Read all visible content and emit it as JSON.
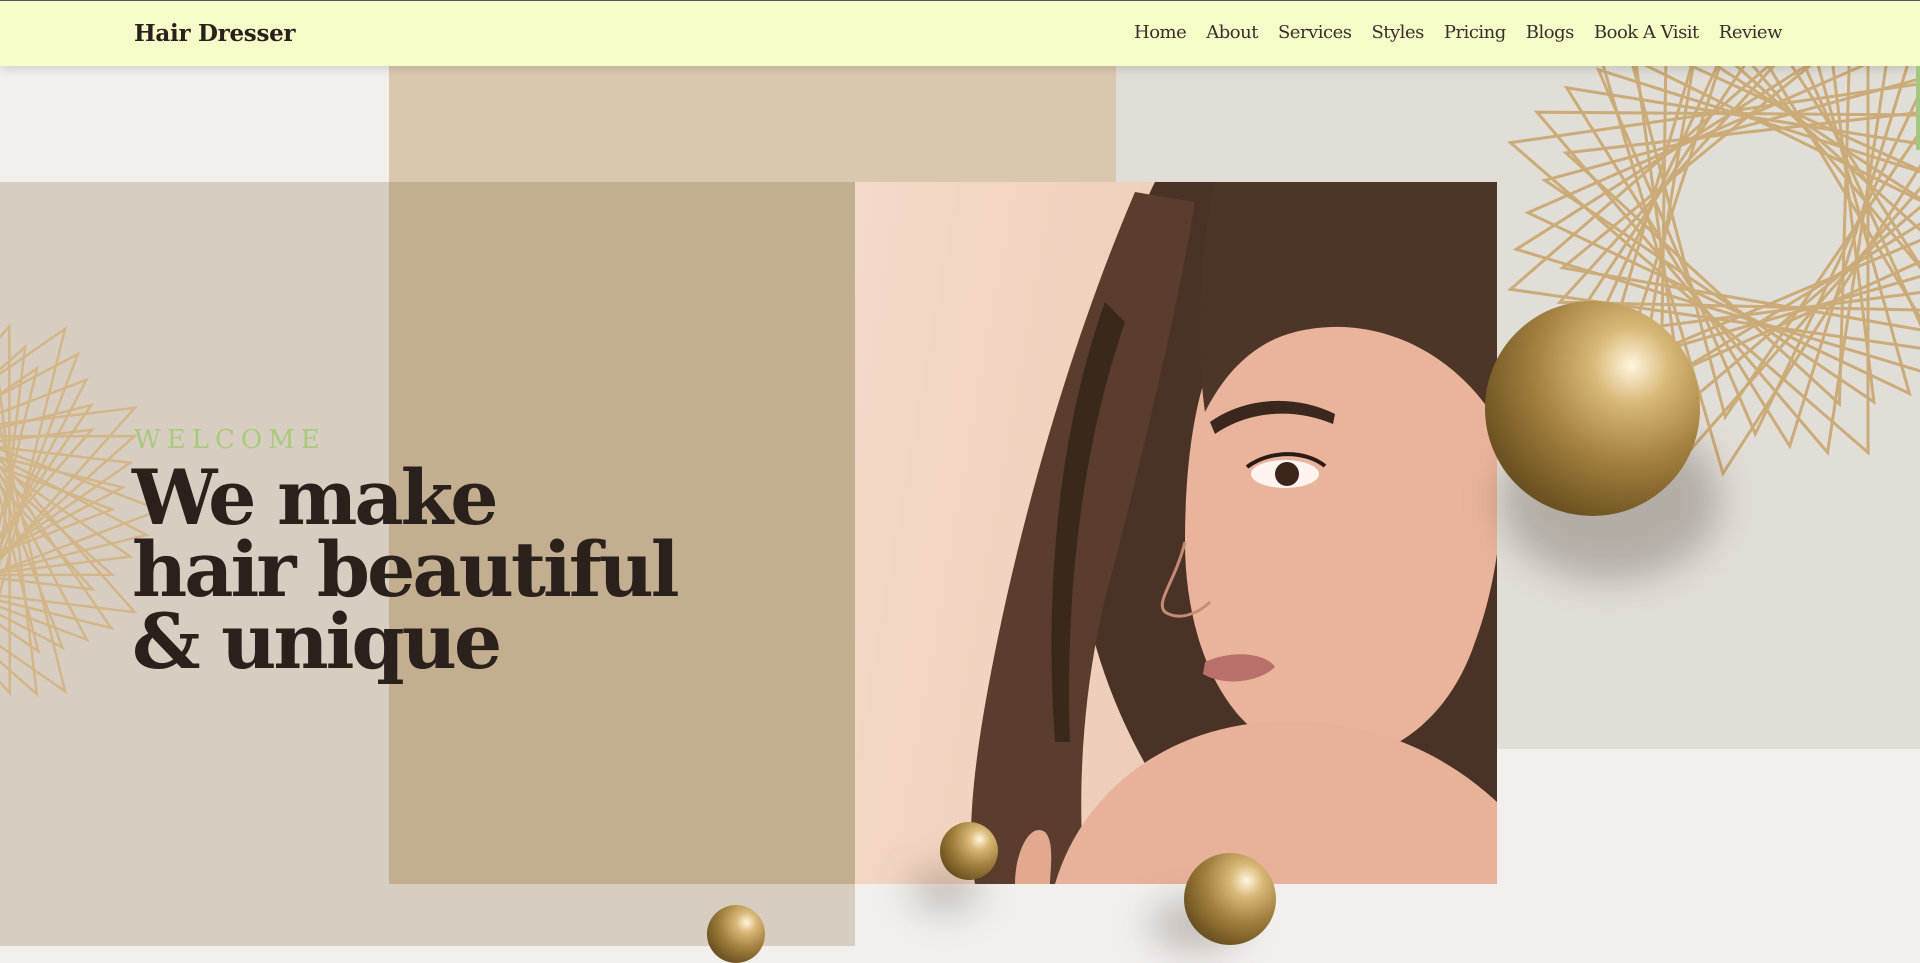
{
  "brand": {
    "name": "Hair Dresser"
  },
  "nav": {
    "items": [
      {
        "label": "Home"
      },
      {
        "label": "About"
      },
      {
        "label": "Services"
      },
      {
        "label": "Styles"
      },
      {
        "label": "Pricing"
      },
      {
        "label": "Blogs"
      },
      {
        "label": "Book A Visit"
      },
      {
        "label": "Review"
      }
    ]
  },
  "hero": {
    "eyebrow": "WELCOME",
    "headline_lines": [
      "We make",
      "hair beautiful",
      "& unique"
    ]
  },
  "colors": {
    "navbar_bg": "#f6fdc9",
    "accent_green": "#a9c97c",
    "text_dark": "#2a201c",
    "gold": "#b08a4a",
    "tan": "#c3ae90"
  },
  "icons": [
    "gold-sphere-decoration",
    "geometric-line-pattern"
  ]
}
